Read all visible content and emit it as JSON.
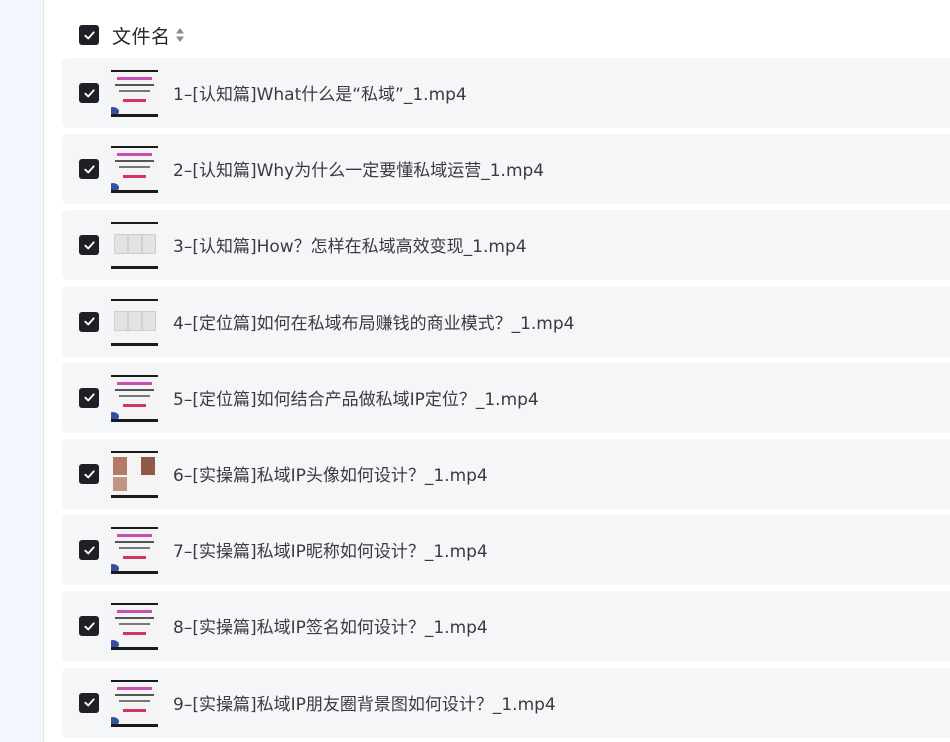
{
  "header": {
    "column_label": "文件名",
    "select_all_checked": true
  },
  "files": [
    {
      "name": "1–[认知篇]What什么是“私域”_1.mp4",
      "checked": true
    },
    {
      "name": "2–[认知篇]Why为什么一定要懂私域运营_1.mp4",
      "checked": true
    },
    {
      "name": "3–[认知篇]How？怎样在私域高效变现_1.mp4",
      "checked": true
    },
    {
      "name": "4–[定位篇]如何在私域布局赚钱的商业模式？_1.mp4",
      "checked": true
    },
    {
      "name": "5–[定位篇]如何结合产品做私域IP定位？_1.mp4",
      "checked": true
    },
    {
      "name": "6–[实操篇]私域IP头像如何设计？_1.mp4",
      "checked": true
    },
    {
      "name": "7–[实操篇]私域IP昵称如何设计？_1.mp4",
      "checked": true
    },
    {
      "name": "8–[实操篇]私域IP签名如何设计？_1.mp4",
      "checked": true
    },
    {
      "name": "9–[实操篇]私域IP朋友圈背景图如何设计？_1.mp4",
      "checked": true
    }
  ],
  "icons": {
    "checkbox_checked": "check-icon",
    "sort": "sort-icon",
    "thumbnail": "video-thumbnail"
  },
  "colors": {
    "checkbox": "#1f1f26",
    "row_background": "#f5f6f8",
    "sidebar_background": "#f3f6fd",
    "text": "#3a3b40"
  }
}
